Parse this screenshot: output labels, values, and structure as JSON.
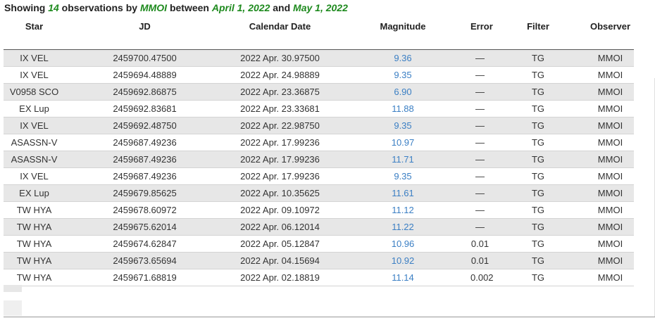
{
  "summary": {
    "prefix": "Showing ",
    "count": "14",
    "mid1": " observations by ",
    "observer": "MMOI",
    "mid2": " between ",
    "start_date": "April 1, 2022",
    "mid3": " and ",
    "end_date": "May 1, 2022"
  },
  "table": {
    "headers": {
      "star": "Star",
      "jd": "JD",
      "calendar_date": "Calendar Date",
      "magnitude": "Magnitude",
      "error": "Error",
      "filter": "Filter",
      "observer": "Observer"
    },
    "rows": [
      {
        "star": "IX VEL",
        "jd": "2459700.47500",
        "date": "2022 Apr. 30.97500",
        "mag": "9.36",
        "err": "—",
        "filter": "TG",
        "observer": "MMOI"
      },
      {
        "star": "IX VEL",
        "jd": "2459694.48889",
        "date": "2022 Apr. 24.98889",
        "mag": "9.35",
        "err": "—",
        "filter": "TG",
        "observer": "MMOI"
      },
      {
        "star": "V0958 SCO",
        "jd": "2459692.86875",
        "date": "2022 Apr. 23.36875",
        "mag": "6.90",
        "err": "—",
        "filter": "TG",
        "observer": "MMOI"
      },
      {
        "star": "EX Lup",
        "jd": "2459692.83681",
        "date": "2022 Apr. 23.33681",
        "mag": "11.88",
        "err": "—",
        "filter": "TG",
        "observer": "MMOI"
      },
      {
        "star": "IX VEL",
        "jd": "2459692.48750",
        "date": "2022 Apr. 22.98750",
        "mag": "9.35",
        "err": "—",
        "filter": "TG",
        "observer": "MMOI"
      },
      {
        "star": "ASASSN-V",
        "jd": "2459687.49236",
        "date": "2022 Apr. 17.99236",
        "mag": "10.97",
        "err": "—",
        "filter": "TG",
        "observer": "MMOI"
      },
      {
        "star": "ASASSN-V",
        "jd": "2459687.49236",
        "date": "2022 Apr. 17.99236",
        "mag": "11.71",
        "err": "—",
        "filter": "TG",
        "observer": "MMOI"
      },
      {
        "star": "IX VEL",
        "jd": "2459687.49236",
        "date": "2022 Apr. 17.99236",
        "mag": "9.35",
        "err": "—",
        "filter": "TG",
        "observer": "MMOI"
      },
      {
        "star": "EX Lup",
        "jd": "2459679.85625",
        "date": "2022 Apr. 10.35625",
        "mag": "11.61",
        "err": "—",
        "filter": "TG",
        "observer": "MMOI"
      },
      {
        "star": "TW HYA",
        "jd": "2459678.60972",
        "date": "2022 Apr. 09.10972",
        "mag": "11.12",
        "err": "—",
        "filter": "TG",
        "observer": "MMOI"
      },
      {
        "star": "TW HYA",
        "jd": "2459675.62014",
        "date": "2022 Apr. 06.12014",
        "mag": "11.22",
        "err": "—",
        "filter": "TG",
        "observer": "MMOI"
      },
      {
        "star": "TW HYA",
        "jd": "2459674.62847",
        "date": "2022 Apr. 05.12847",
        "mag": "10.96",
        "err": "0.01",
        "filter": "TG",
        "observer": "MMOI"
      },
      {
        "star": "TW HYA",
        "jd": "2459673.65694",
        "date": "2022 Apr. 04.15694",
        "mag": "10.92",
        "err": "0.01",
        "filter": "TG",
        "observer": "MMOI"
      },
      {
        "star": "TW HYA",
        "jd": "2459671.68819",
        "date": "2022 Apr. 02.18819",
        "mag": "11.14",
        "err": "0.002",
        "filter": "TG",
        "observer": "MMOI"
      }
    ]
  },
  "colors": {
    "highlight_green": "#1e8a1e",
    "magnitude_link": "#3b7fc4",
    "row_stripe": "#e7e7e7"
  }
}
